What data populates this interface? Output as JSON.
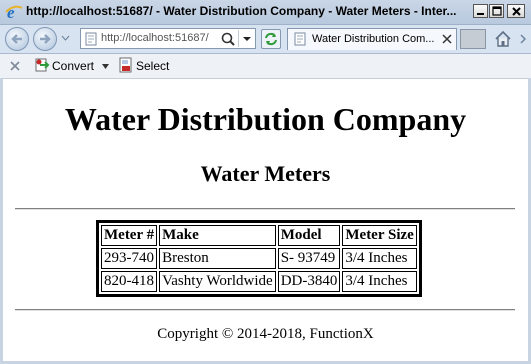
{
  "window": {
    "title": "http://localhost:51687/ - Water Distribution Company - Water Meters - Inter..."
  },
  "navbar": {
    "address": "http://localhost:51687/",
    "tab_label": "Water Distribution Com..."
  },
  "commandbar": {
    "convert_label": "Convert",
    "select_label": "Select"
  },
  "page": {
    "heading": "Water Distribution Company",
    "subheading": "Water Meters",
    "table": {
      "headers": [
        "Meter #",
        "Make",
        "Model",
        "Meter Size"
      ],
      "rows": [
        [
          "293-740",
          "Breston",
          "S- 93749",
          "3/4 Inches"
        ],
        [
          "820-418",
          "Vashty Worldwide",
          "DD-3840",
          "3/4 Inches"
        ]
      ]
    },
    "footer": "Copyright © 2014-2018, FunctionX"
  },
  "icons": {
    "browser": "ie-logo-icon",
    "back": "back-arrow-icon",
    "forward": "forward-arrow-icon",
    "search": "search-icon",
    "refresh": "refresh-icon",
    "home": "home-icon",
    "convert": "pdf-convert-icon",
    "select": "pdf-select-icon"
  },
  "colors": {
    "titlebar": "#c9d6e6",
    "navbar": "#d7e3f0",
    "page_background": "#ffffff",
    "ie_blue": "#1f6fc4"
  }
}
